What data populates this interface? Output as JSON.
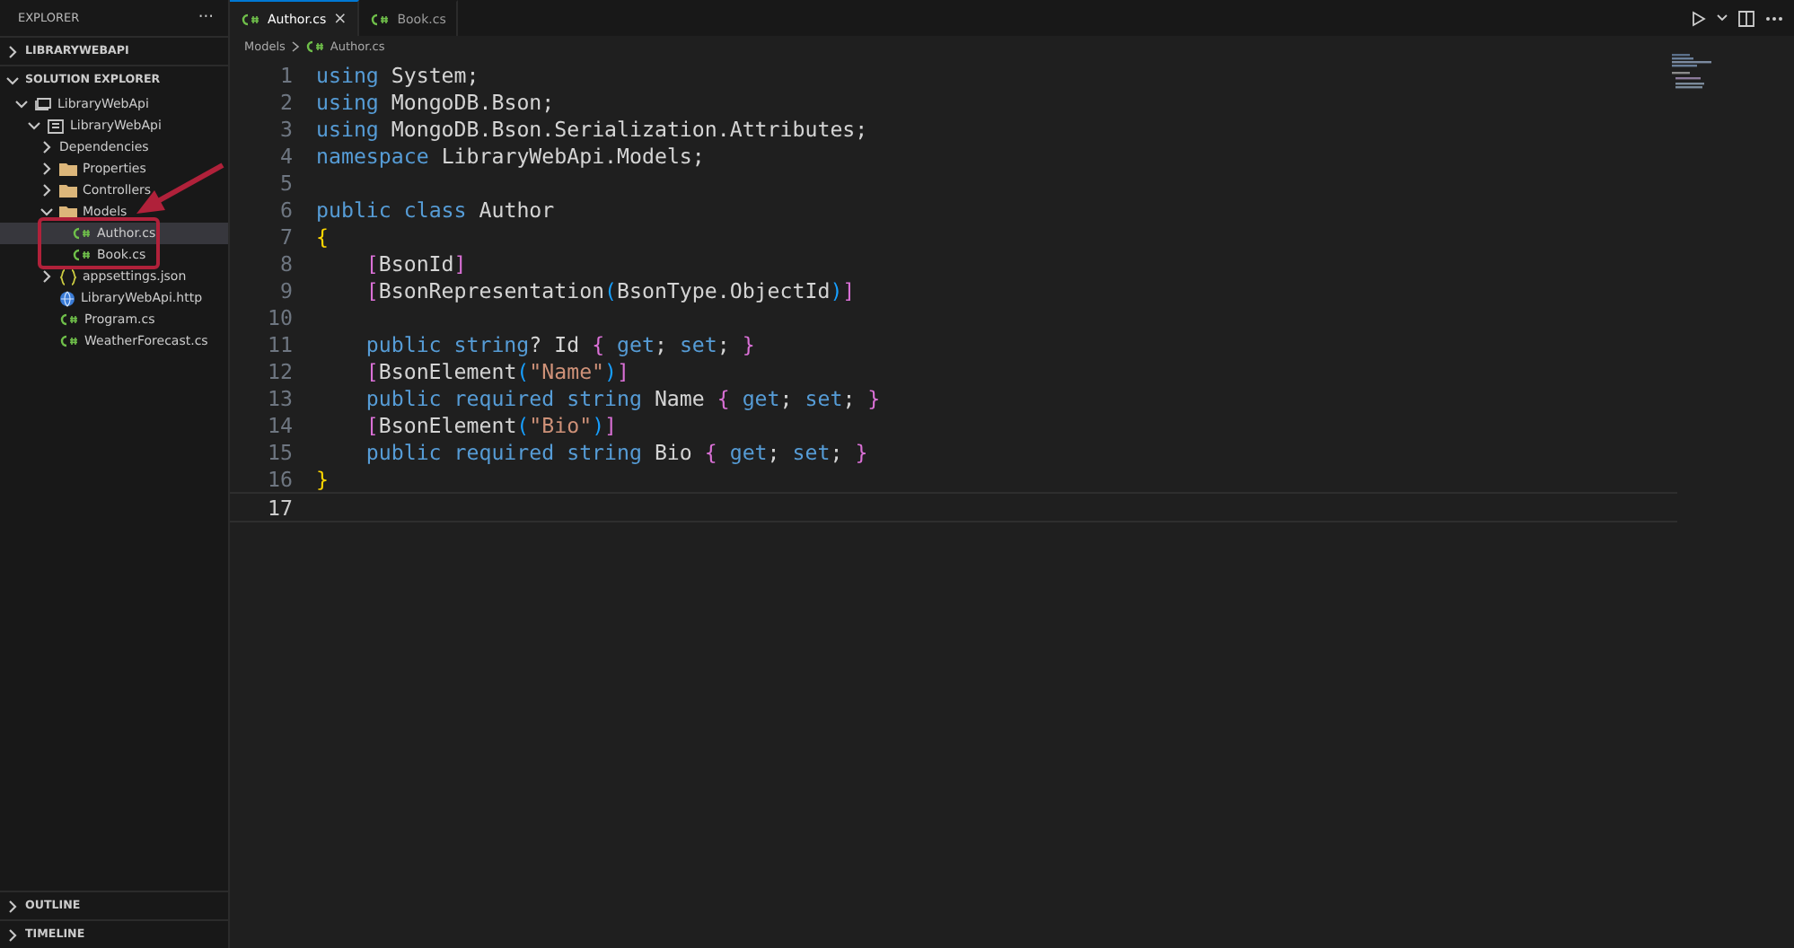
{
  "sidebar": {
    "title": "EXPLORER",
    "more": "···",
    "sections": [
      {
        "title": "LIBRARYWEBAPI",
        "expanded": false
      },
      {
        "title": "SOLUTION EXPLORER",
        "expanded": true
      }
    ],
    "tree": [
      {
        "label": "LibraryWebApi",
        "kind": "solution",
        "expanded": true,
        "selected": false,
        "children": [
          {
            "label": "LibraryWebApi",
            "kind": "project",
            "expanded": true,
            "selected": false,
            "children": [
              {
                "label": "Dependencies",
                "kind": "dependencies",
                "expanded": false,
                "selected": false
              },
              {
                "label": "Properties",
                "kind": "folder",
                "expanded": false,
                "selected": false
              },
              {
                "label": "Controllers",
                "kind": "folder",
                "expanded": false,
                "selected": false
              },
              {
                "label": "Models",
                "kind": "folder",
                "expanded": true,
                "selected": false,
                "children": [
                  {
                    "label": "Author.cs",
                    "kind": "csharp",
                    "selected": true
                  },
                  {
                    "label": "Book.cs",
                    "kind": "csharp",
                    "selected": false
                  }
                ]
              },
              {
                "label": "appsettings.json",
                "kind": "json",
                "expanded": false,
                "selected": false
              },
              {
                "label": "LibraryWebApi.http",
                "kind": "http",
                "selected": false
              },
              {
                "label": "Program.cs",
                "kind": "csharp",
                "selected": false
              },
              {
                "label": "WeatherForecast.cs",
                "kind": "csharp",
                "selected": false
              }
            ]
          }
        ]
      }
    ],
    "bottom_sections": [
      {
        "title": "OUTLINE",
        "expanded": false
      },
      {
        "title": "TIMELINE",
        "expanded": false
      }
    ]
  },
  "tabs": [
    {
      "label": "Author.cs",
      "selected": true,
      "close": "×"
    },
    {
      "label": "Book.cs",
      "selected": false
    }
  ],
  "breadcrumb": [
    "Models",
    "Author.cs"
  ],
  "code": [
    {
      "number": "1",
      "current": false,
      "tokens": [
        {
          "text": "using ",
          "kind": "keyword"
        },
        {
          "text": "System;",
          "kind": "plain"
        }
      ]
    },
    {
      "number": "2",
      "current": false,
      "tokens": [
        {
          "text": "using ",
          "kind": "keyword"
        },
        {
          "text": "MongoDB.Bson;",
          "kind": "plain"
        }
      ]
    },
    {
      "number": "3",
      "current": false,
      "tokens": [
        {
          "text": "using ",
          "kind": "keyword"
        },
        {
          "text": "MongoDB.Bson.Serialization.Attributes;",
          "kind": "plain"
        }
      ]
    },
    {
      "number": "4",
      "current": false,
      "tokens": [
        {
          "text": "namespace ",
          "kind": "keyword"
        },
        {
          "text": "LibraryWebApi.Models;",
          "kind": "plain"
        }
      ]
    },
    {
      "number": "5",
      "current": false
    },
    {
      "number": "6",
      "current": false,
      "tokens": [
        {
          "text": "public class ",
          "kind": "keyword"
        },
        {
          "text": "Author",
          "kind": "plain"
        }
      ]
    },
    {
      "number": "7",
      "current": false,
      "tokens": [
        {
          "text": "{",
          "kind": "bracket1"
        }
      ]
    },
    {
      "number": "8",
      "current": false,
      "indented": true,
      "tokens": [
        {
          "text": "[",
          "kind": "bracket2"
        },
        {
          "text": "BsonId",
          "kind": "plain"
        },
        {
          "text": "]",
          "kind": "bracket2"
        }
      ]
    },
    {
      "number": "9",
      "current": false,
      "indented": true,
      "tokens": [
        {
          "text": "[",
          "kind": "bracket2"
        },
        {
          "text": "BsonRepresentation",
          "kind": "plain"
        },
        {
          "text": "(",
          "kind": "bracket3"
        },
        {
          "text": "BsonType.ObjectId",
          "kind": "plain"
        },
        {
          "text": ")",
          "kind": "bracket3"
        },
        {
          "text": "]",
          "kind": "bracket2"
        }
      ]
    },
    {
      "number": "10",
      "current": false
    },
    {
      "number": "11",
      "current": false,
      "indented": true,
      "tokens": [
        {
          "text": "public string",
          "kind": "keyword"
        },
        {
          "text": "? Id ",
          "kind": "plain"
        },
        {
          "text": "{ ",
          "kind": "bracket2"
        },
        {
          "text": "get",
          "kind": "keyword"
        },
        {
          "text": "; ",
          "kind": "plain"
        },
        {
          "text": "set",
          "kind": "keyword"
        },
        {
          "text": "; ",
          "kind": "plain"
        },
        {
          "text": "}",
          "kind": "bracket2"
        }
      ]
    },
    {
      "number": "12",
      "current": false,
      "indented": true,
      "tokens": [
        {
          "text": "[",
          "kind": "bracket2"
        },
        {
          "text": "BsonElement",
          "kind": "plain"
        },
        {
          "text": "(",
          "kind": "bracket3"
        },
        {
          "text": "\"Name\"",
          "kind": "string"
        },
        {
          "text": ")",
          "kind": "bracket3"
        },
        {
          "text": "]",
          "kind": "bracket2"
        }
      ]
    },
    {
      "number": "13",
      "current": false,
      "indented": true,
      "tokens": [
        {
          "text": "public required string ",
          "kind": "keyword"
        },
        {
          "text": "Name ",
          "kind": "plain"
        },
        {
          "text": "{ ",
          "kind": "bracket2"
        },
        {
          "text": "get",
          "kind": "keyword"
        },
        {
          "text": "; ",
          "kind": "plain"
        },
        {
          "text": "set",
          "kind": "keyword"
        },
        {
          "text": "; ",
          "kind": "plain"
        },
        {
          "text": "}",
          "kind": "bracket2"
        }
      ]
    },
    {
      "number": "14",
      "current": false,
      "indented": true,
      "tokens": [
        {
          "text": "[",
          "kind": "bracket2"
        },
        {
          "text": "BsonElement",
          "kind": "plain"
        },
        {
          "text": "(",
          "kind": "bracket3"
        },
        {
          "text": "\"Bio\"",
          "kind": "string"
        },
        {
          "text": ")",
          "kind": "bracket3"
        },
        {
          "text": "]",
          "kind": "bracket2"
        }
      ]
    },
    {
      "number": "15",
      "current": false,
      "indented": true,
      "tokens": [
        {
          "text": "public required string ",
          "kind": "keyword"
        },
        {
          "text": "Bio ",
          "kind": "plain"
        },
        {
          "text": "{ ",
          "kind": "bracket2"
        },
        {
          "text": "get",
          "kind": "keyword"
        },
        {
          "text": "; ",
          "kind": "plain"
        },
        {
          "text": "set",
          "kind": "keyword"
        },
        {
          "text": "; ",
          "kind": "plain"
        },
        {
          "text": "}",
          "kind": "bracket2"
        }
      ]
    },
    {
      "number": "16",
      "current": false,
      "tokens": [
        {
          "text": "}",
          "kind": "bracket1"
        }
      ]
    },
    {
      "number": "17",
      "current": true
    }
  ]
}
